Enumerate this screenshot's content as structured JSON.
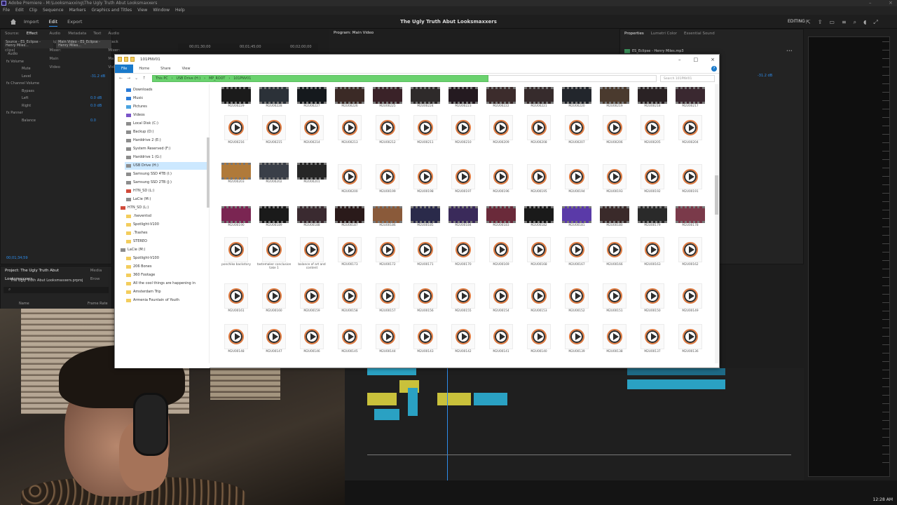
{
  "app": {
    "title": "Adobe Premiere - M:\\Looksmaxxing\\The Ugly Truth Abut Looksmaxxers",
    "menu": [
      "File",
      "Edit",
      "Clip",
      "Sequence",
      "Markers",
      "Graphics and Titles",
      "View",
      "Window",
      "Help"
    ],
    "workspace_tabs": [
      "Import",
      "Edit",
      "Export"
    ],
    "active_workspace": "Edit",
    "document_title": "The Ugly Truth Abut Looksmaxxers",
    "mode_label": "EDITING"
  },
  "source_panel": {
    "tabs": [
      "Source: (no clips)",
      "Effect Controls",
      "Audio Clip Mixer: Main Video",
      "Metadata",
      "Text",
      "Audio Track Mixer: Main Video"
    ],
    "active_tab": "Effect Controls",
    "clip_tabs": [
      "Source - ES_Eclipse - Henry Miles...",
      "Main Video - ES_Eclipse - Henry Miles..."
    ],
    "ruler_times": [
      "00;01;30;00",
      "00;01;45;00",
      "00;02;00;00"
    ],
    "fx_rows": [
      {
        "label": "Audio",
        "value": ""
      },
      {
        "label": "fx  Volume",
        "value": ""
      },
      {
        "label": "Mute",
        "value": ""
      },
      {
        "label": "Level",
        "value": "-31.2 dB"
      },
      {
        "label": "fx  Channel Volume",
        "value": ""
      },
      {
        "label": "Bypass",
        "value": ""
      },
      {
        "label": "Left",
        "value": "0.0 dB"
      },
      {
        "label": "Right",
        "value": "0.0 dB"
      },
      {
        "label": "fx  Panner",
        "value": ""
      },
      {
        "label": "Balance",
        "value": "0.0"
      }
    ],
    "timecode": "00;01;34;59"
  },
  "program_panel": {
    "title": "Program: Main Video"
  },
  "properties_panel": {
    "tabs": [
      "Properties",
      "Lumetri Color",
      "Essential Sound"
    ],
    "active_tab": "Properties",
    "clip_name": "ES_Eclipse - Henry Miles.mp3",
    "level_value": "-31.2 dB"
  },
  "project_panel": {
    "tabs": [
      "Project: The Ugly Truth Abut Looksmaxxers",
      "Media Brow"
    ],
    "file_name": "The Ugly Truth Abut Looksmaxxers.prproj",
    "columns": [
      "Name",
      "Frame Rate"
    ]
  },
  "explorer": {
    "window_title": "101PNV01",
    "ribbon": [
      "File",
      "Home",
      "Share",
      "View"
    ],
    "address": [
      "This PC",
      "USB Drive (H:)",
      "MP_ROOT",
      "101PNV01"
    ],
    "search_placeholder": "Search 101PNV01",
    "nav_items": [
      {
        "label": "Downloads",
        "icon": "downloads-icon",
        "selected": false,
        "indent": 1
      },
      {
        "label": "Music",
        "icon": "music-icon",
        "selected": false,
        "indent": 1
      },
      {
        "label": "Pictures",
        "icon": "pictures-icon",
        "selected": false,
        "indent": 1
      },
      {
        "label": "Videos",
        "icon": "videos-icon",
        "selected": false,
        "indent": 1
      },
      {
        "label": "Local Disk (C:)",
        "icon": "drive-icon",
        "selected": false,
        "indent": 1
      },
      {
        "label": "Backup (D:)",
        "icon": "drive-icon",
        "selected": false,
        "indent": 1
      },
      {
        "label": "Harddrive 2 (E:)",
        "icon": "drive-icon",
        "selected": false,
        "indent": 1
      },
      {
        "label": "System Reserved (F:)",
        "icon": "drive-icon",
        "selected": false,
        "indent": 1
      },
      {
        "label": "Harddrive 1 (G:)",
        "icon": "drive-icon",
        "selected": false,
        "indent": 1
      },
      {
        "label": "USB Drive (H:)",
        "icon": "drive-icon",
        "selected": true,
        "indent": 1
      },
      {
        "label": "Samsung SSD 4TB (I:)",
        "icon": "drive-icon",
        "selected": false,
        "indent": 1
      },
      {
        "label": "Samsung SSD 2TB (J:)",
        "icon": "drive-icon",
        "selected": false,
        "indent": 1
      },
      {
        "label": "H7N_SD (L:)",
        "icon": "sd-card-icon",
        "selected": false,
        "indent": 1
      },
      {
        "label": "LaCie (M:)",
        "icon": "drive-icon",
        "selected": false,
        "indent": 1
      },
      {
        "label": "H7N_SD (L:)",
        "icon": "sd-card-icon",
        "selected": false,
        "indent": 0
      },
      {
        "label": ".fseventsd",
        "icon": "folder-icon",
        "selected": false,
        "indent": 1
      },
      {
        "label": "Spotlight-V100",
        "icon": "folder-icon",
        "selected": false,
        "indent": 1
      },
      {
        "label": ".Trashes",
        "icon": "folder-icon",
        "selected": false,
        "indent": 1
      },
      {
        "label": "STEREO",
        "icon": "folder-icon",
        "selected": false,
        "indent": 1
      },
      {
        "label": "LaCie (M:)",
        "icon": "drive-icon",
        "selected": false,
        "indent": 0
      },
      {
        "label": "Spotlight-V100",
        "icon": "folder-icon",
        "selected": false,
        "indent": 1
      },
      {
        "label": "206 Bones",
        "icon": "folder-icon",
        "selected": false,
        "indent": 1
      },
      {
        "label": "360 Footage",
        "icon": "folder-icon",
        "selected": false,
        "indent": 1
      },
      {
        "label": "All the cool things are happening in",
        "icon": "folder-icon",
        "selected": false,
        "indent": 1
      },
      {
        "label": "Amsterdam Trip",
        "icon": "folder-icon",
        "selected": false,
        "indent": 1
      },
      {
        "label": "Armenia Fountain of Youth",
        "icon": "folder-icon",
        "selected": false,
        "indent": 1
      }
    ],
    "rows": [
      {
        "kind": "thumb",
        "files": [
          "M2U00229",
          "M2U00228",
          "M2U00227",
          "M2U00226",
          "M2U00225",
          "M2U00224",
          "M2U00223",
          "M2U00222",
          "M2U00221",
          "M2U00220",
          "M2U00219",
          "M2U00218",
          "M2U00217"
        ]
      },
      {
        "kind": "play",
        "files": [
          "M2U00216",
          "M2U00215",
          "M2U00214",
          "M2U00213",
          "M2U00212",
          "M2U00211",
          "M2U00210",
          "M2U00209",
          "M2U00208",
          "M2U00207",
          "M2U00206",
          "M2U00205",
          "M2U00204"
        ]
      },
      {
        "kind": "mixed",
        "thumbs": 3,
        "files": [
          "M2U00203",
          "M2U00202",
          "M2U00201",
          "M2U00200",
          "M2U00199",
          "M2U00198",
          "M2U00197",
          "M2U00196",
          "M2U00195",
          "M2U00194",
          "M2U00193",
          "M2U00192",
          "M2U00191"
        ]
      },
      {
        "kind": "thumb",
        "files": [
          "M2U00190",
          "M2U00189",
          "M2U00188",
          "M2U00187",
          "M2U00186",
          "M2U00185",
          "M2U00184",
          "M2U00183",
          "M2U00182",
          "M2U00181",
          "M2U00180",
          "M2U00179",
          "M2U00178"
        ]
      },
      {
        "kind": "play",
        "files": [
          "ponchiko backstory",
          "tastemaker conclusion take 1",
          "balance of art and content",
          "M2U00173",
          "M2U00172",
          "M2U00171",
          "M2U00170",
          "M2U00169",
          "M2U00168",
          "M2U00167",
          "M2U00166",
          "M2U00163",
          "M2U00162"
        ]
      },
      {
        "kind": "play",
        "files": [
          "M2U00161",
          "M2U00160",
          "M2U00159",
          "M2U00158",
          "M2U00157",
          "M2U00156",
          "M2U00155",
          "M2U00154",
          "M2U00153",
          "M2U00152",
          "M2U00151",
          "M2U00150",
          "M2U00149"
        ]
      },
      {
        "kind": "play",
        "files": [
          "M2U00148",
          "M2U00147",
          "M2U00146",
          "M2U00145",
          "M2U00144",
          "M2U00143",
          "M2U00142",
          "M2U00141",
          "M2U00140",
          "M2U00139",
          "M2U00138",
          "M2U00137",
          "M2U00136"
        ]
      }
    ]
  },
  "taskbar": {
    "clock": "12:28 AM"
  },
  "colors": {
    "premiere_accent": "#2d8ceb",
    "explorer_accent": "#1979ca",
    "address_highlight": "#6ad26e"
  }
}
